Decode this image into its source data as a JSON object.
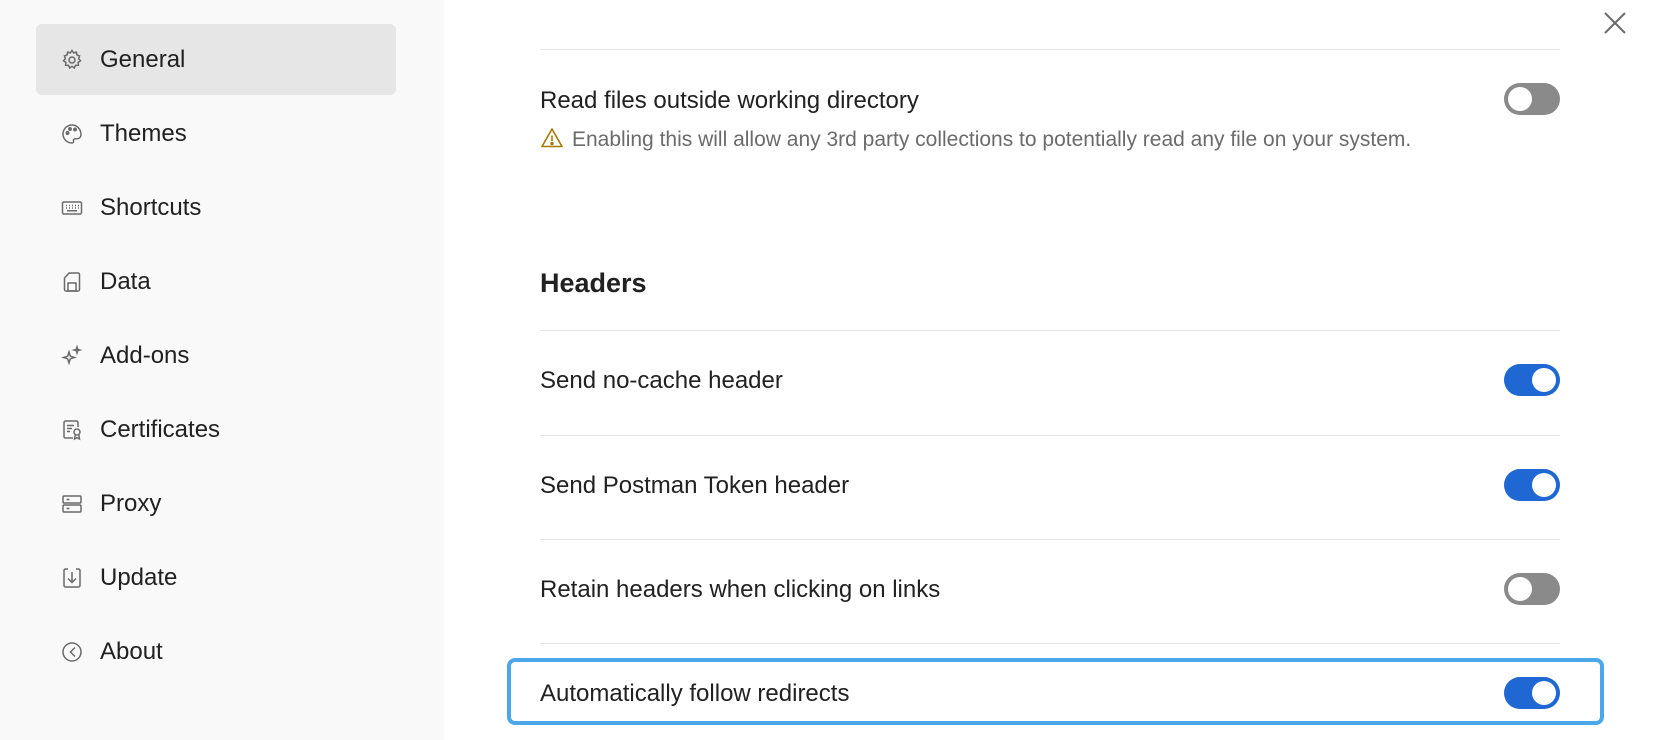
{
  "sidebar": {
    "items": [
      {
        "label": "General",
        "icon": "gear-icon",
        "active": true
      },
      {
        "label": "Themes",
        "icon": "palette-icon",
        "active": false
      },
      {
        "label": "Shortcuts",
        "icon": "keyboard-icon",
        "active": false
      },
      {
        "label": "Data",
        "icon": "data-icon",
        "active": false
      },
      {
        "label": "Add-ons",
        "icon": "sparkle-icon",
        "active": false
      },
      {
        "label": "Certificates",
        "icon": "certificate-icon",
        "active": false
      },
      {
        "label": "Proxy",
        "icon": "server-icon",
        "active": false
      },
      {
        "label": "Update",
        "icon": "download-icon",
        "active": false
      },
      {
        "label": "About",
        "icon": "about-icon",
        "active": false
      }
    ]
  },
  "main": {
    "close_icon": "close-icon",
    "read_files": {
      "label": "Read files outside working directory",
      "warning": "Enabling this will allow any 3rd party collections to potentially read any file on your system.",
      "enabled": false
    },
    "headers_title": "Headers",
    "settings": [
      {
        "label": "Send no-cache header",
        "enabled": true
      },
      {
        "label": "Send Postman Token header",
        "enabled": true
      },
      {
        "label": "Retain headers when clicking on links",
        "enabled": false
      },
      {
        "label": "Automatically follow redirects",
        "enabled": true
      }
    ]
  },
  "colors": {
    "toggle_on": "#1f67d3",
    "toggle_off": "#8a8a8a",
    "focus_ring": "#4aa8ea",
    "warning": "#a37a00"
  }
}
